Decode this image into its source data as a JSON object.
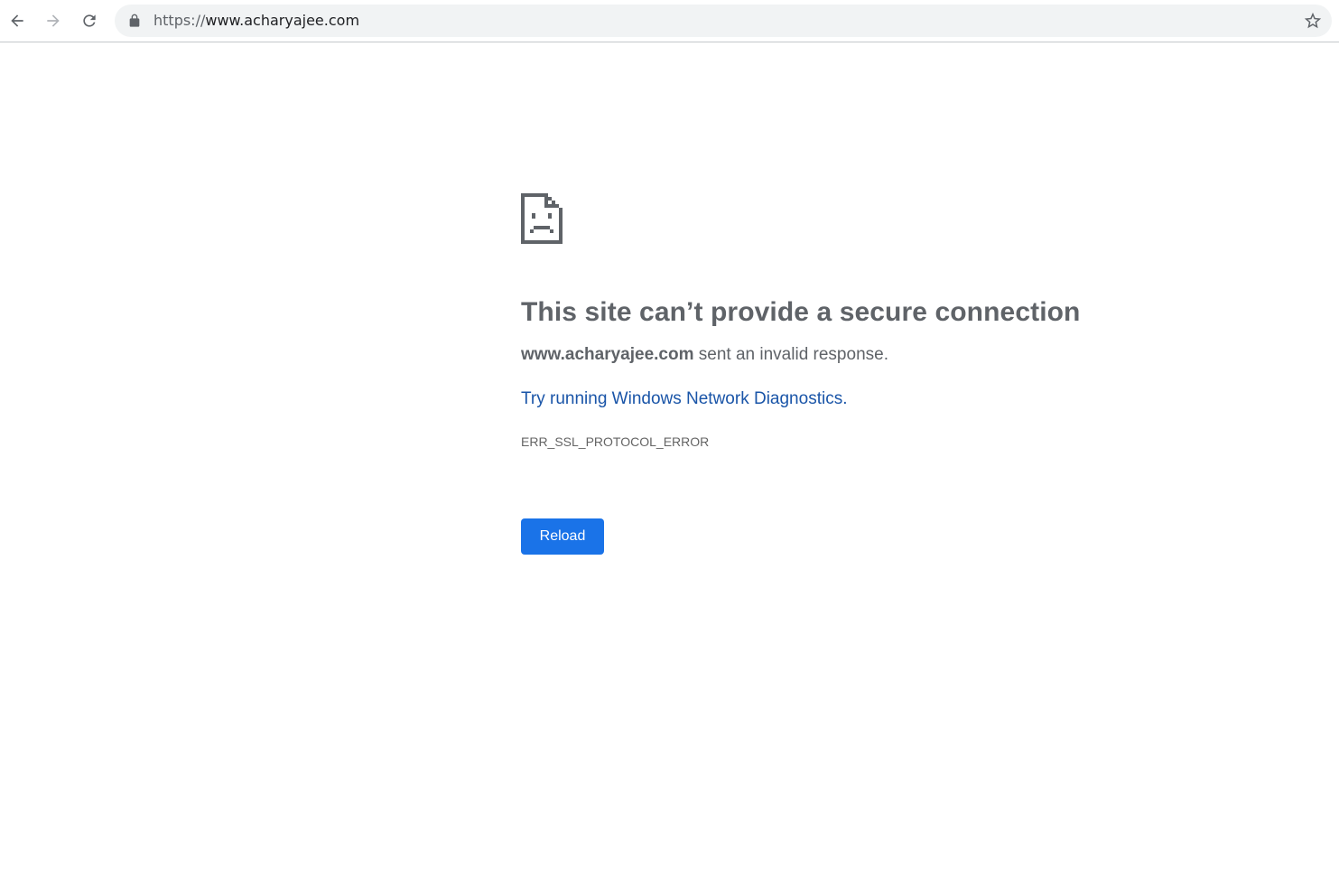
{
  "browser": {
    "url_scheme": "https://",
    "url_host": "www.acharyajee.com",
    "icons": [
      "back-arrow-icon",
      "forward-arrow-icon",
      "reload-icon",
      "lock-icon",
      "bookmark-star-icon"
    ]
  },
  "error_page": {
    "icon": "sad-page-icon",
    "heading": "This site can’t provide a secure connection",
    "description_host": "www.acharyajee.com",
    "description_rest": " sent an invalid response.",
    "diagnostics_link": "Try running Windows Network Diagnostics.",
    "error_code": "ERR_SSL_PROTOCOL_ERROR",
    "reload_label": "Reload"
  },
  "colors": {
    "accent": "#1a73e8",
    "link": "#1a55a8",
    "text": "#5f6368"
  }
}
